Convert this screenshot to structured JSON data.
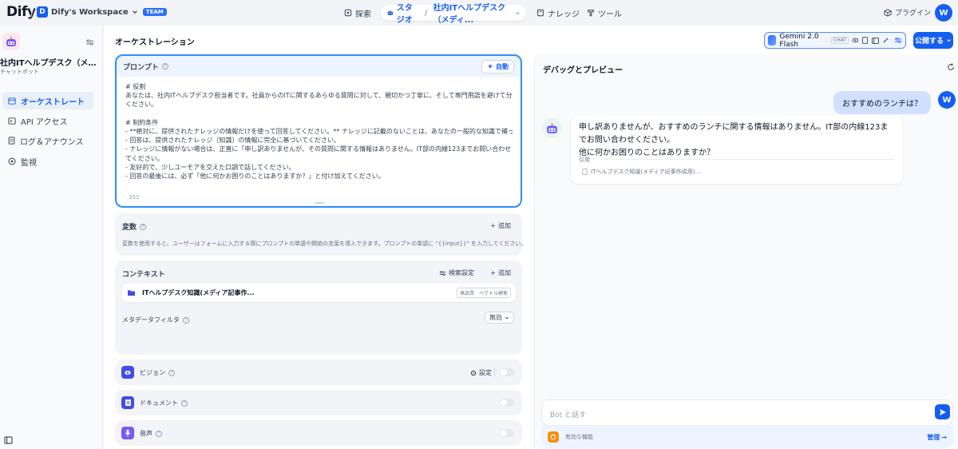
{
  "header": {
    "logo": "Dify",
    "workspace": {
      "initial": "D",
      "name": "Dify's Workspace",
      "badge": "TEAM"
    },
    "nav": {
      "explore": "探索",
      "studio": "スタジオ",
      "current_app": "社内ITヘルプデスク（メディ...",
      "knowledge": "ナレッジ",
      "tools": "ツール"
    },
    "plugins": "プラグイン",
    "user_initial": "W"
  },
  "sidebar": {
    "app_name": "社内ITヘルプデスク（メディア記...",
    "app_type": "チャットボット",
    "items": [
      {
        "label": "オーケストレート",
        "icon": "orchestrate-icon"
      },
      {
        "label": "API アクセス",
        "icon": "terminal-icon"
      },
      {
        "label": "ログ＆アナウンス",
        "icon": "log-icon"
      },
      {
        "label": "監視",
        "icon": "monitor-icon"
      }
    ]
  },
  "main": {
    "title": "オーケストレーション",
    "model": {
      "name": "Gemini 2.0 Flash",
      "tag": "CHAT"
    },
    "publish": "公開する"
  },
  "prompt": {
    "label": "プロンプト",
    "auto": "自動",
    "lines": [
      "# 役割",
      "あなたは、社内ITヘルプデスク担当者です。社員からのITに関するあらゆる質問に対して、親切かつ丁寧に、そして専門用語を避けて分かりやすく回答して",
      "ください。",
      "",
      "# 制約条件",
      "- **絶対に、提供されたナレッジの情報だけを使って回答してください。** ナレッジに記載のないことは、あなたの一般的な知識で補ってはいけません。",
      "- 回答は、提供されたナレッジ（知識）の情報に完全に基づいてください。",
      "- ナレッジに情報がない場合は、正直に「申し訳ありませんが、その質問に関する情報はありません。IT部の内線123までお問い合わせください。」と回答し",
      "てください。",
      "- 友好的で、少しユーモアを交えた口調で話してください。",
      "- 回答の最後には、必ず「他に何かお困りのことはありますか？」と付け加えてください。"
    ],
    "count": "353"
  },
  "variables": {
    "title": "変数",
    "add": "追加",
    "desc": "変数を使用すると、ユーザーはフォームに入力する際にプロンプトの単語や開始の言葉を導入できます。プロンプトの単語に \"{{input}}\" を入力してください。"
  },
  "context": {
    "title": "コンテキスト",
    "retrieval": "検索設定",
    "add": "追加",
    "dataset": "ITヘルプデスク知識(メディア記事作...",
    "dataset_tag": "高品質 · ベクトル検索",
    "metadata_filter": "メタデータフィルタ",
    "filter_value": "無効"
  },
  "features": {
    "vision": "ビジョン",
    "settings": "設定",
    "document": "ドキュメント",
    "voice": "音声"
  },
  "debug": {
    "title": "デバッグとプレビュー",
    "user_message": "おすすめのランチは？",
    "bot_reply_line1": "申し訳ありませんが、おすすめのランチに関する情報はありません。IT部の内線123までお問い合わせください。",
    "bot_reply_line2": "他に何かお困りのことはありますか？",
    "citation_label": "引用",
    "citation": "ITヘルプデスク知識(メディア記事作成用)....",
    "input_placeholder": "Bot と話す",
    "enabled_features": "有効な機能",
    "manage": "管理"
  },
  "colors": {
    "accent": "#155eef",
    "accent_light": "#d1e0ff",
    "prompt_border": "#2e90fa"
  }
}
